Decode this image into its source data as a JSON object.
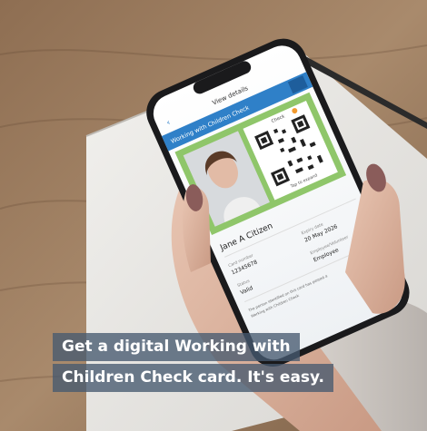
{
  "caption": {
    "line1": "Get a digital Working with",
    "line2": "Children Check card. It's easy."
  },
  "phone_screen": {
    "header_title": "View details",
    "card_title": "Working with Children Check",
    "status_chip": "Check",
    "holder_name": "Jane A Citizen",
    "card_number_label": "Card number",
    "card_number": "12345678",
    "expiry_label": "Expiry date",
    "expiry_date": "20 May 2026",
    "status_label": "Status",
    "status_value": "Valid",
    "type_label": "Employee/Volunteer",
    "type_value": "Employee",
    "qr_caption": "Tap to expand",
    "footer_note": "The person identified on this card has passed a Working with Children Check"
  },
  "colors": {
    "caption_bg": "#465a70",
    "card_header_blue": "#2f80c8",
    "card_frame_green": "#8fc66a",
    "table_wood": "#9a7a5e",
    "notebook_white": "#ecebe8"
  }
}
